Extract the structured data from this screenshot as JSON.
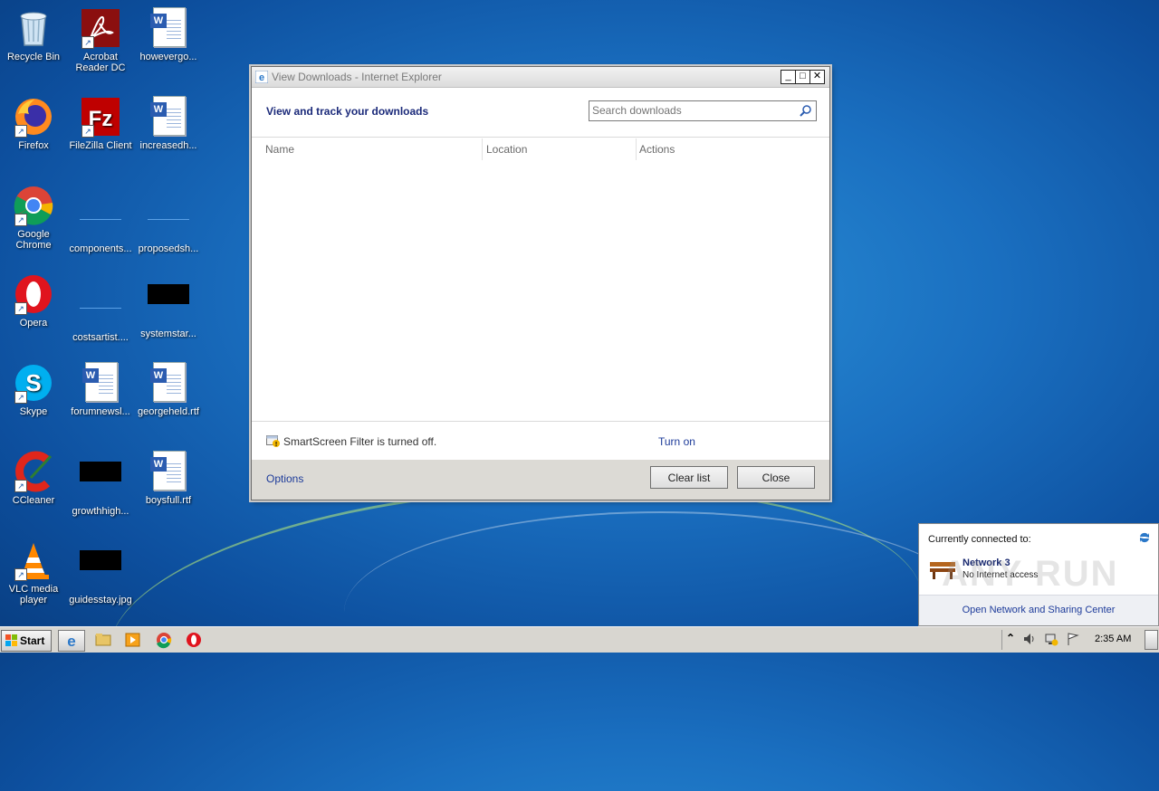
{
  "desktop": {
    "icons": [
      {
        "label": "Recycle Bin"
      },
      {
        "label": "Acrobat Reader DC"
      },
      {
        "label": "howevergo..."
      },
      {
        "label": "Firefox"
      },
      {
        "label": "FileZilla Client"
      },
      {
        "label": "increasedh..."
      },
      {
        "label": "Google Chrome"
      },
      {
        "label": "components..."
      },
      {
        "label": "proposedsh..."
      },
      {
        "label": "Opera"
      },
      {
        "label": "costsartist...."
      },
      {
        "label": "systemstar..."
      },
      {
        "label": "Skype"
      },
      {
        "label": "forumnewsl..."
      },
      {
        "label": "georgeheld.rtf"
      },
      {
        "label": "CCleaner"
      },
      {
        "label": "growthhigh..."
      },
      {
        "label": "boysfull.rtf"
      },
      {
        "label": "VLC media player"
      },
      {
        "label": "guidesstay.jpg"
      }
    ]
  },
  "dialog": {
    "title": "View Downloads - Internet Explorer",
    "header": "View and track your downloads",
    "search_placeholder": "Search downloads",
    "columns": [
      "Name",
      "Location",
      "Actions"
    ],
    "smartscreen_text": "SmartScreen Filter is turned off.",
    "turn_on": "Turn on",
    "options": "Options",
    "clear_list": "Clear list",
    "close": "Close",
    "minimize_glyph": "_",
    "maximize_glyph": "□",
    "close_glyph": "✕"
  },
  "network_popup": {
    "connected_to": "Currently connected to:",
    "network_name": "Network  3",
    "status": "No Internet access",
    "link": "Open Network and Sharing Center",
    "watermark": "ANY RUN"
  },
  "taskbar": {
    "start_label": "Start",
    "clock": "2:35 AM",
    "tray_expand_glyph": "⌃"
  },
  "colors": {
    "desktop_blue": "#1a6fc0",
    "link_blue": "#1d3b9a",
    "header_blue": "#1b2a7a"
  }
}
